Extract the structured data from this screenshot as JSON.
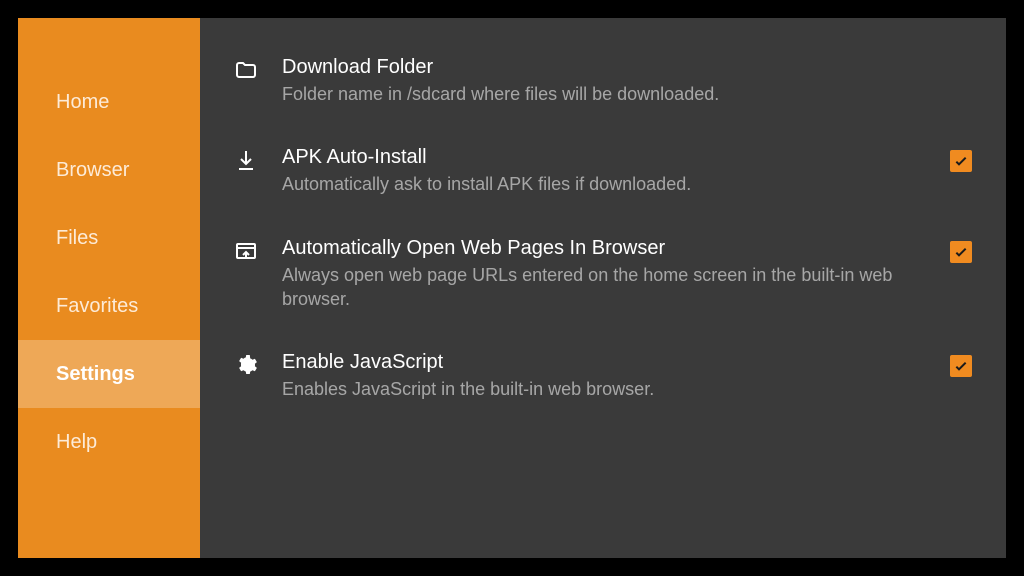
{
  "sidebar": {
    "items": [
      {
        "label": "Home",
        "key": "home"
      },
      {
        "label": "Browser",
        "key": "browser"
      },
      {
        "label": "Files",
        "key": "files"
      },
      {
        "label": "Favorites",
        "key": "favorites"
      },
      {
        "label": "Settings",
        "key": "settings"
      },
      {
        "label": "Help",
        "key": "help"
      }
    ],
    "selected": "settings"
  },
  "settings": {
    "download_folder": {
      "title": "Download Folder",
      "sub": "Folder name in /sdcard where files will be downloaded."
    },
    "apk_auto_install": {
      "title": "APK Auto-Install",
      "sub": "Automatically ask to install APK files if downloaded.",
      "checked": true
    },
    "auto_open_browser": {
      "title": "Automatically Open Web Pages In Browser",
      "sub": "Always open web page URLs entered on the home screen in the built-in web browser.",
      "checked": true
    },
    "enable_js": {
      "title": "Enable JavaScript",
      "sub": "Enables JavaScript in the built-in web browser.",
      "checked": true
    }
  }
}
